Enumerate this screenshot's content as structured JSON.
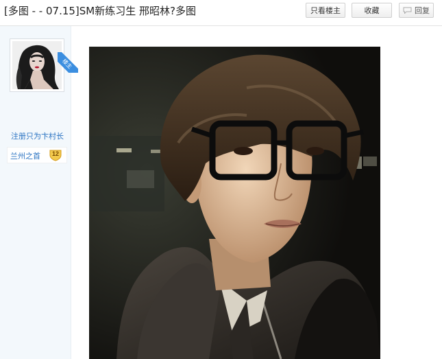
{
  "header": {
    "thread_title": "[多图 - - 07.15]SM新练习生 邢昭林?多图",
    "only_op_label": "只看楼主",
    "favorite_label": "收藏",
    "reply_label": "回复"
  },
  "author": {
    "op_badge": "楼主",
    "username": "注册只为卞村长",
    "rank_title": "兰州之首",
    "level": "12"
  },
  "colors": {
    "link_blue": "#2a73c2",
    "panel_bg": "#f3f8fc",
    "op_ribbon": "#3b8ee0",
    "level_gold": "#f2c94c"
  },
  "icons": {
    "reply": "speech-bubble-icon",
    "level": "shield-badge-icon"
  }
}
